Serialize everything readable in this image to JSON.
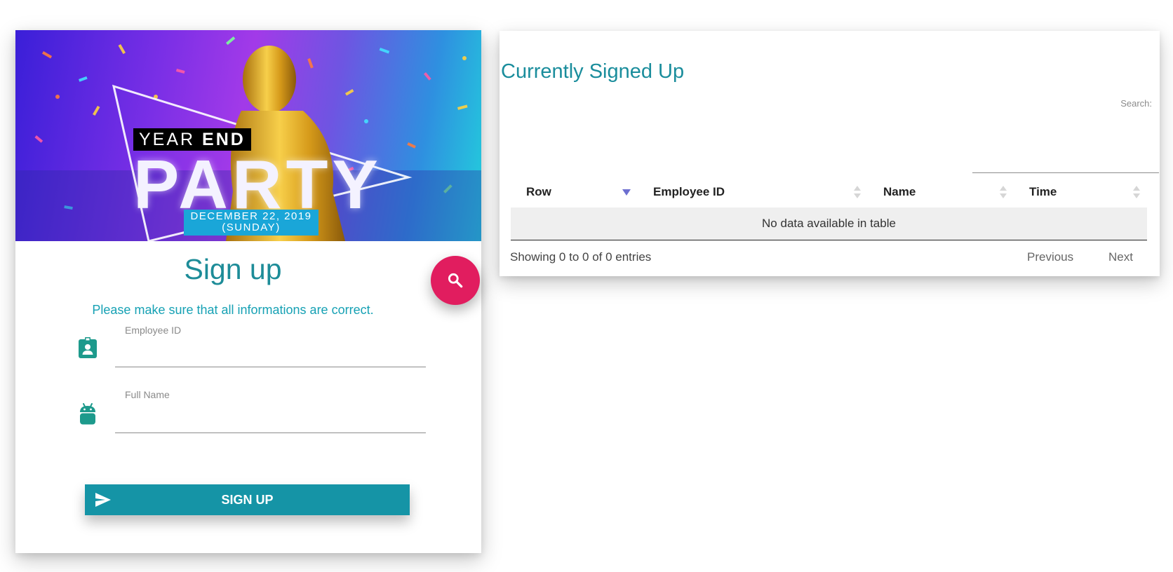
{
  "banner": {
    "year_label": "YEAR",
    "end_label": "END",
    "party_label": "PARTY",
    "date_line1": "DECEMBER 22, 2019",
    "date_line2": "(SUNDAY)"
  },
  "signup": {
    "title": "Sign up",
    "hint": "Please make sure that all informations are correct.",
    "fields": [
      {
        "label": "Employee ID",
        "value": "",
        "icon": "id-badge-icon"
      },
      {
        "label": "Full Name",
        "value": "",
        "icon": "android-icon"
      }
    ],
    "button_label": "SIGN UP",
    "button_icon": "send-icon",
    "fab_icon": "search-icon"
  },
  "list": {
    "title": "Currently Signed Up",
    "search_label": "Search:",
    "search_value": "",
    "columns": [
      {
        "label": "Row",
        "sort": "descending"
      },
      {
        "label": "Employee ID",
        "sort": "none"
      },
      {
        "label": "Name",
        "sort": "none"
      },
      {
        "label": "Time",
        "sort": "none"
      }
    ],
    "empty_message": "No data available in table",
    "info": "Showing 0 to 0 of 0 entries",
    "previous_label": "Previous",
    "next_label": "Next"
  },
  "colors": {
    "accent_teal": "#1594a6",
    "fab_pink": "#e11d5f",
    "title_teal": "#1a8d9c"
  }
}
